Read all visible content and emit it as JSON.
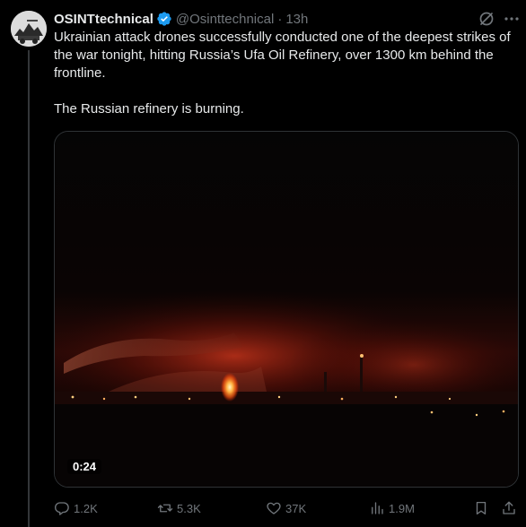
{
  "post": {
    "author_name": "OSINTtechnical",
    "handle": "@Osinttechnical",
    "separator": "·",
    "time": "13h",
    "text_paragraphs": [
      "Ukrainian attack drones successfully conducted one of the deepest strikes of the war tonight, hitting Russia’s Ufa Oil Refinery, over 1300 km behind the frontline.",
      "The Russian refinery is burning."
    ],
    "video": {
      "duration": "0:24"
    },
    "stats": {
      "replies": "1.2K",
      "reposts": "5.3K",
      "likes": "37K",
      "views": "1.9M"
    }
  },
  "icons": {
    "verified": "verified-badge-icon",
    "grok": "grok-icon",
    "more": "more-icon",
    "reply": "reply-icon",
    "repost": "repost-icon",
    "like": "heart-icon",
    "views": "analytics-icon",
    "bookmark": "bookmark-icon",
    "share": "share-icon"
  },
  "colors": {
    "background": "#000000",
    "text_primary": "#e7e9ea",
    "text_secondary": "#71767b",
    "border": "#2f3336",
    "verified": "#1d9bf0",
    "fire": "#ff6a00"
  }
}
